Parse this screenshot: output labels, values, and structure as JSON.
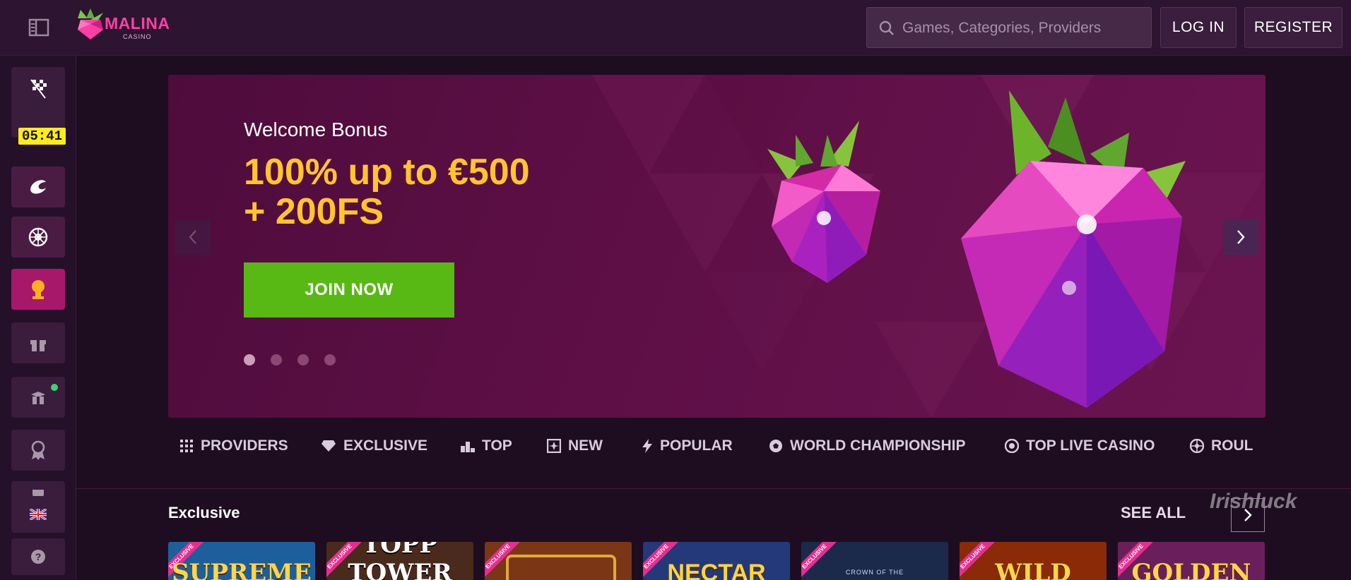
{
  "header": {
    "logo_text": "MALINA",
    "logo_sub": "CASINO",
    "search_placeholder": "Games, Categories, Providers",
    "login_label": "LOG IN",
    "register_label": "REGISTER"
  },
  "sidebar": {
    "timer": "05:41"
  },
  "banner": {
    "kicker": "Welcome Bonus",
    "headline_line1": "100% up to €500",
    "headline_line2": "+ 200FS",
    "cta_label": "JOIN NOW",
    "slide_count": 4,
    "active_slide": 1
  },
  "categories": [
    {
      "label": "PROVIDERS",
      "icon": "grid-icon"
    },
    {
      "label": "EXCLUSIVE",
      "icon": "diamond-icon"
    },
    {
      "label": "TOP",
      "icon": "podium-icon"
    },
    {
      "label": "NEW",
      "icon": "new-icon"
    },
    {
      "label": "POPULAR",
      "icon": "lightning-icon"
    },
    {
      "label": "WORLD CHAMPIONSHIP",
      "icon": "soccer-ball-icon"
    },
    {
      "label": "TOP LIVE CASINO",
      "icon": "chip-icon"
    },
    {
      "label": "ROUL",
      "icon": "roulette-icon"
    }
  ],
  "section": {
    "title": "Exclusive",
    "see_all": "SEE ALL"
  },
  "watermark": "Irishluck",
  "games": [
    {
      "tag": "EXCLUSIVE",
      "title": "SUPREME",
      "bg": "#1d5f9c"
    },
    {
      "tag": "EXCLUSIVE",
      "title": "TOPP TOWER",
      "bg": "#4a2a1c"
    },
    {
      "tag": "EXCLUSIVE",
      "title": "",
      "bg": "#7a3615"
    },
    {
      "tag": "EXCLUSIVE",
      "title": "NECTAR",
      "bg": "#23397a"
    },
    {
      "tag": "EXCLUSIVE",
      "title": "CROWN OF THE",
      "bg": "#1b2a4a"
    },
    {
      "tag": "EXCLUSIVE",
      "title": "WILD",
      "bg": "#8a2a06"
    },
    {
      "tag": "EXCLUSIVE",
      "title": "GOLDEN",
      "bg": "#6a1f5c"
    }
  ],
  "colors": {
    "accent_pink": "#ff3fa4",
    "bonus_yellow": "#ffc52b",
    "cta_green": "#58b814",
    "timer_yellow": "#ffec1c"
  }
}
